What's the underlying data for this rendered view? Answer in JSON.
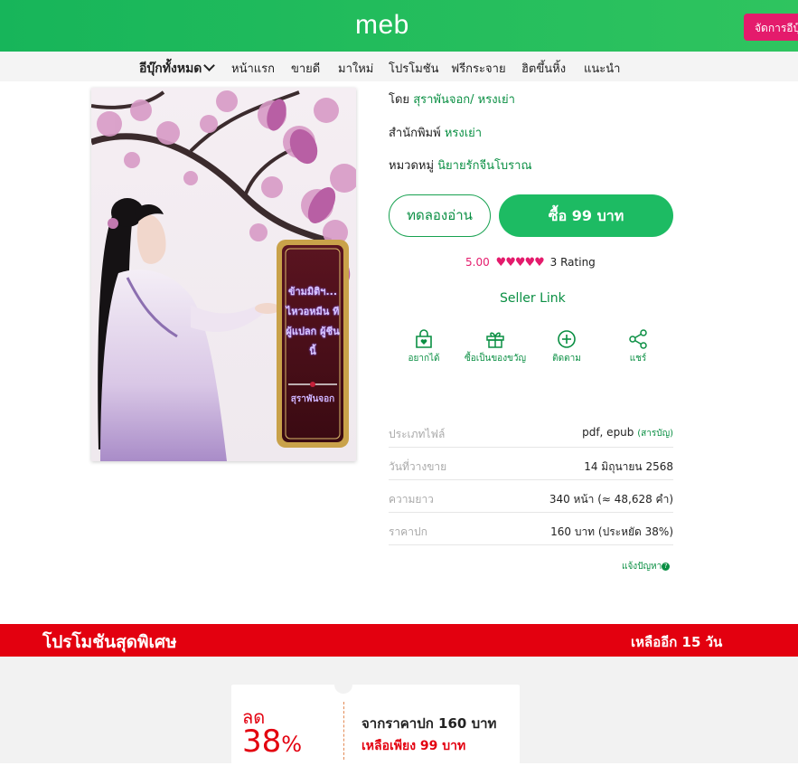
{
  "header": {
    "logo": "meb",
    "manage_button": "จัดการอีบุ๊ก",
    "brand_color": "#1dbb63",
    "accent_color": "#e41b6c"
  },
  "nav": {
    "all_label": "อีบุ๊กทั้งหมด",
    "items": [
      "หน้าแรก",
      "ขายดี",
      "มาใหม่",
      "โปรโมชัน",
      "ฟรีกระจาย",
      "ฮิตขึ้นหิ้ง",
      "แนะนำ"
    ]
  },
  "cover": {
    "title_text": "ข้ามมิติฯ... ไหวอหมีน ทีผู้แปลก ผู้ชีนนี้",
    "author_text": "สุราพันจอก"
  },
  "book": {
    "by_label": "โดย",
    "author": "สุราพันจอก/ หรงเย่า",
    "publisher_label": "สำนักพิมพ์",
    "publisher": "หรงเย่า",
    "category_label": "หมวดหมู่",
    "category": "นิยายรักจีนโบราณ"
  },
  "buttons": {
    "try_read": "ทดลองอ่าน",
    "buy": "ซื้อ 99 บาท"
  },
  "rating": {
    "score": "5.00",
    "stars": 5,
    "count_text": "3 Rating"
  },
  "seller_link": "Seller Link",
  "actions": [
    {
      "icon": "bag-heart-icon",
      "label": "อยากได้"
    },
    {
      "icon": "gift-icon",
      "label": "ซื้อเป็นของขวัญ"
    },
    {
      "icon": "plus-circle-icon",
      "label": "ติดตาม"
    },
    {
      "icon": "share-icon",
      "label": "แชร์"
    }
  ],
  "info": {
    "file_type_label": "ประเภทไฟล์",
    "file_type": "pdf, epub",
    "file_type_note": "(สารบัญ)",
    "release_label": "วันที่วางขาย",
    "release": "14 มิถุนายน 2568",
    "length_label": "ความยาว",
    "length": "340 หน้า (≈ 48,628 คำ)",
    "cover_price_label": "ราคาปก",
    "cover_price": "160 บาท (ประหยัด 38%)"
  },
  "report": {
    "label": "แจ้งปัญหา",
    "icon": "question-icon"
  },
  "promo": {
    "title": "โปรโมชันสุดพิเศษ",
    "remaining": "เหลืออีก 15 วัน",
    "discount_label": "ลด",
    "discount_value": "38",
    "discount_unit": "%",
    "from_text": "จากราคาปก 160 บาท",
    "only_text": "เหลือเพียง 99 บาท",
    "color": "#e3000f"
  }
}
